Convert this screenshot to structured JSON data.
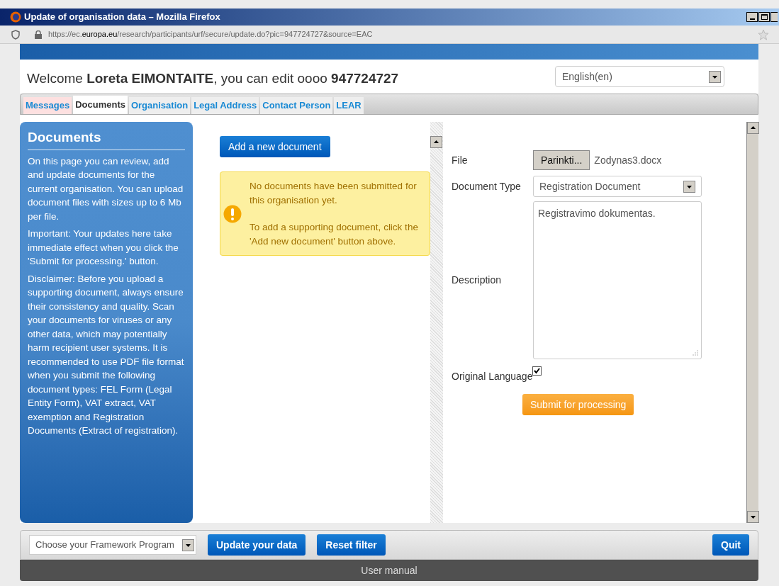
{
  "window": {
    "title": "Update of organisation data – Mozilla Firefox"
  },
  "address_bar": {
    "url_prefix": "https://ec.",
    "url_domain": "europa.eu",
    "url_rest": "/research/participants/urf/secure/update.do?pic=947724727&source=EAC"
  },
  "header": {
    "welcome": "Welcome **Loreta EIMONTAITE**, you can edit oooo **947724727**",
    "language": "English(en)"
  },
  "tabs": [
    {
      "label": "Messages",
      "selected": false,
      "highlighted": true
    },
    {
      "label": "Documents",
      "selected": true,
      "highlighted": false
    },
    {
      "label": "Organisation",
      "selected": false,
      "highlighted": false
    },
    {
      "label": "Legal Address",
      "selected": false,
      "highlighted": false
    },
    {
      "label": "Contact Person",
      "selected": false,
      "highlighted": false
    },
    {
      "label": "LEAR",
      "selected": false,
      "highlighted": false
    }
  ],
  "sidebar": {
    "title": "Documents",
    "paragraphs": [
      "On this page you can review, add and update documents for the current organisation. You can upload document files with sizes up to 6 Mb per file.",
      "Important: Your updates here take immediate effect when you click the 'Submit for processing.' button.",
      "Disclaimer: Before you upload a supporting document, always ensure their consistency and quality. Scan your documents for viruses or any other data, which may potentially harm recipient user systems. It is recommended to use PDF file format when you submit the following document types: FEL Form (Legal Entity Form), VAT extract, VAT exemption and Registration Documents (Extract of registration)."
    ]
  },
  "documents": {
    "add_button": "Add a new document",
    "notice": [
      "No documents have been submitted for this organisation yet.",
      "To add a supporting document, click the 'Add new document' button above."
    ]
  },
  "form": {
    "file_label": "File",
    "file_button": "Parinkti...",
    "file_name": "Zodynas3.docx",
    "type_label": "Document Type",
    "type_value": "Registration Document",
    "description_label": "Description",
    "description_value": "Registravimo dokumentas.",
    "original_language_label": "Original Language",
    "original_language_checked": true,
    "submit": "Submit for processing"
  },
  "footer": {
    "framework_placeholder": "Choose your Framework Program",
    "update_button": "Update your data",
    "reset_button": "Reset filter",
    "quit_button": "Quit",
    "manual": "User manual"
  }
}
